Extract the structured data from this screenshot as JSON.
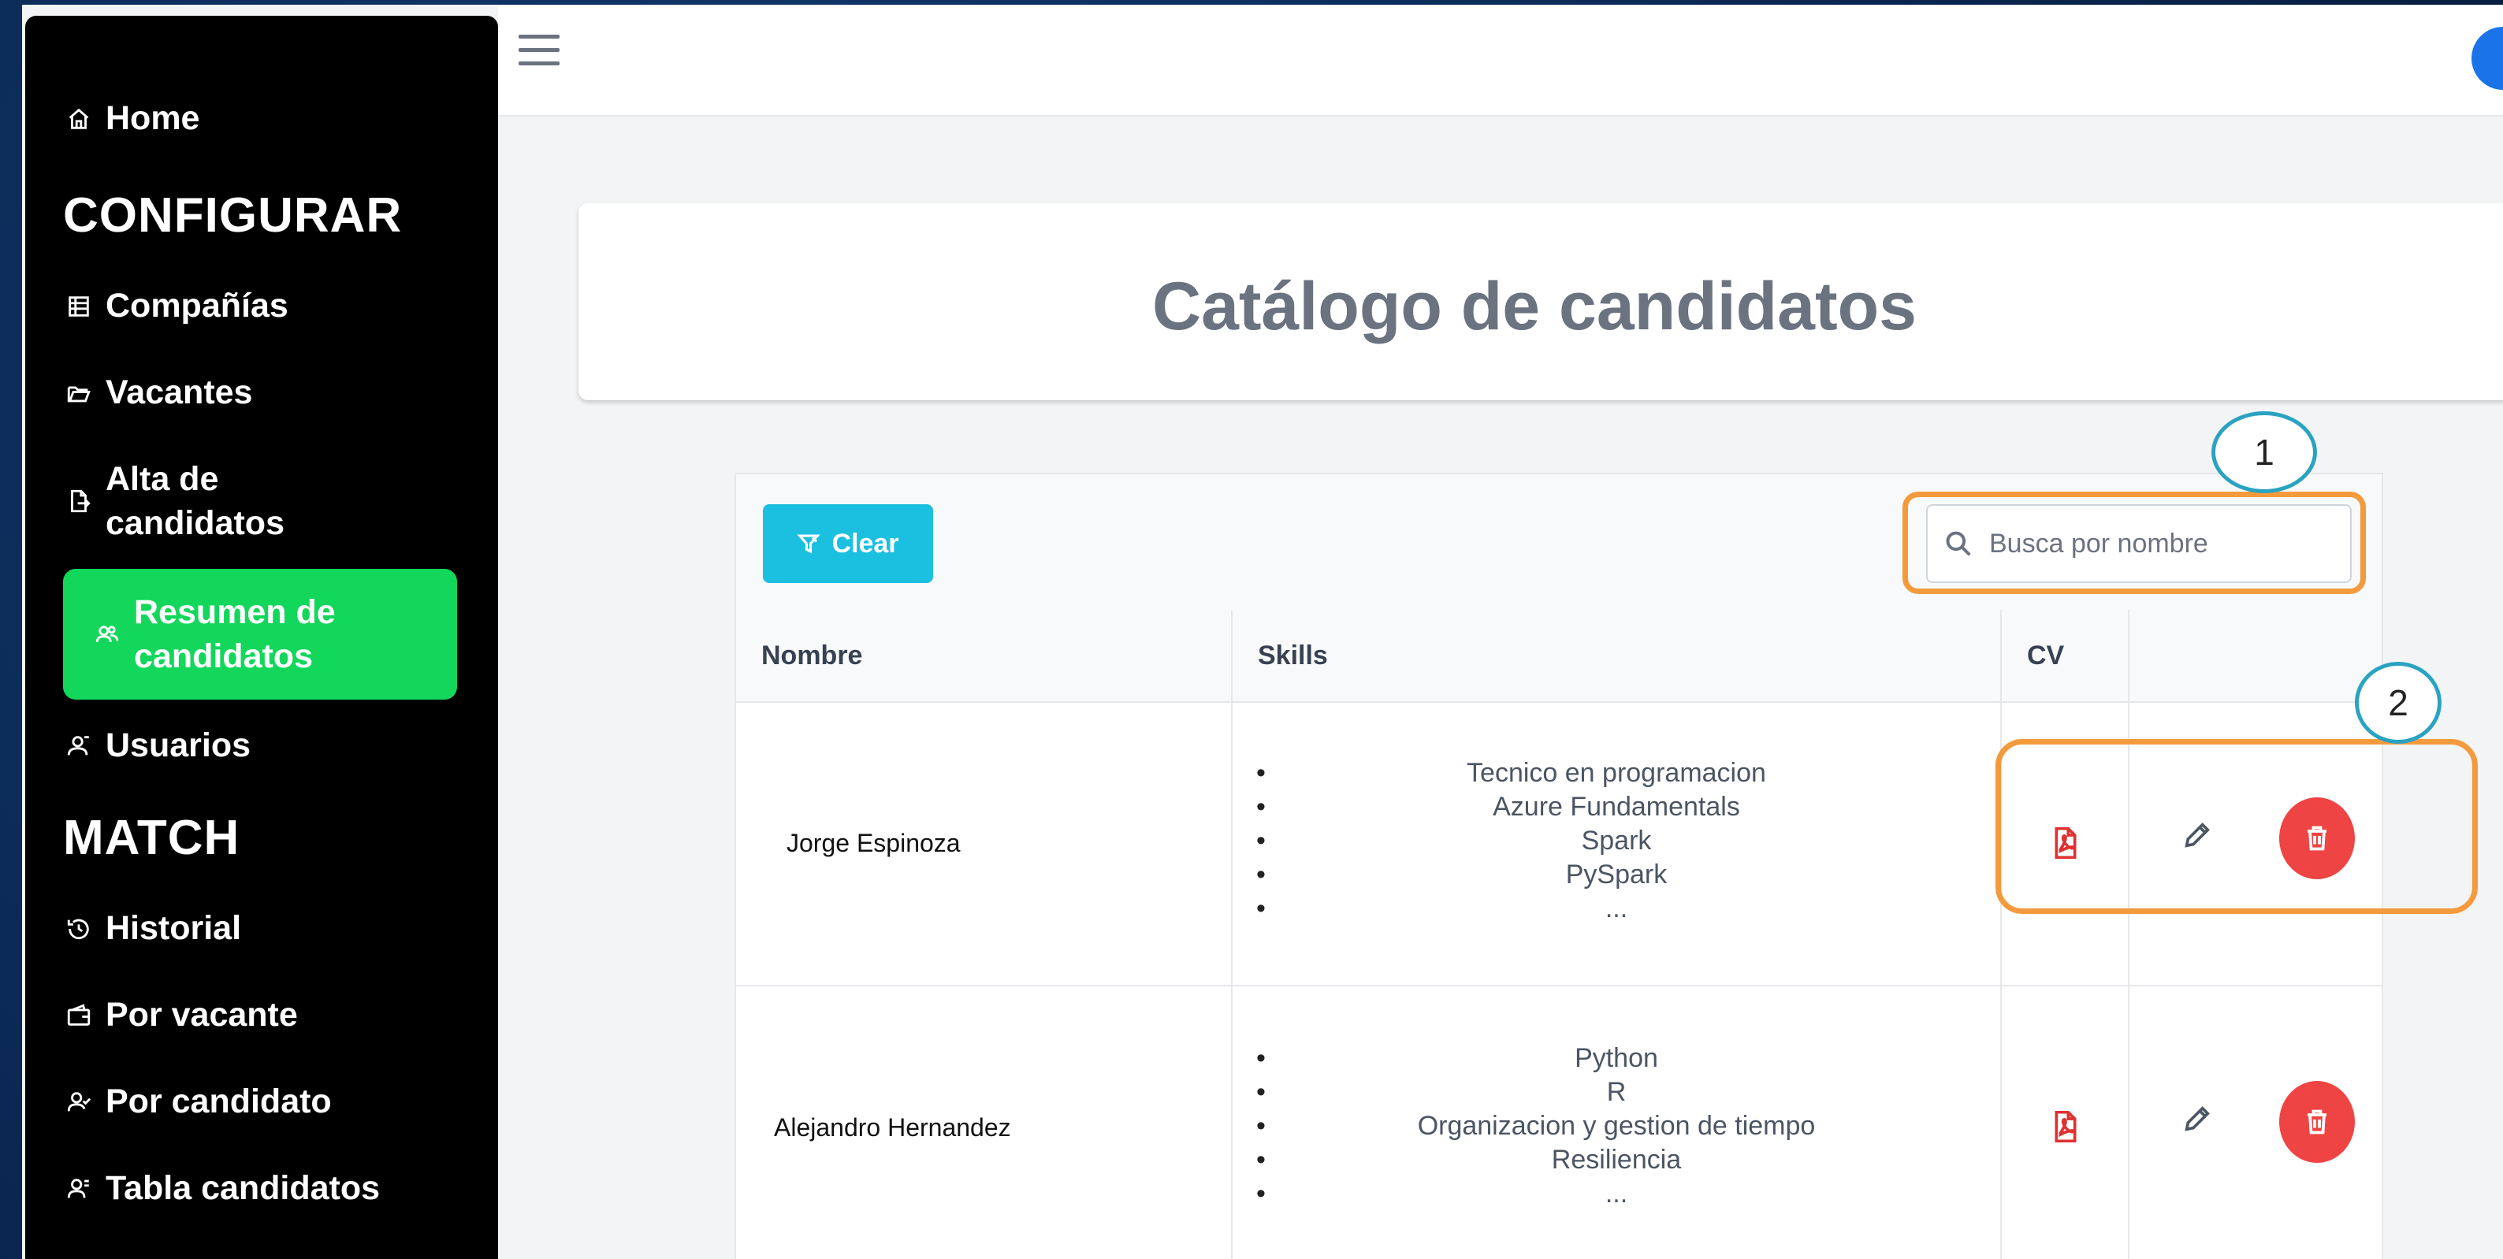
{
  "sidebar": {
    "home": "Home",
    "section_configurar": "CONFIGURAR",
    "companias": "Compañías",
    "vacantes": "Vacantes",
    "alta_line1": "Alta de",
    "alta_line2": "candidatos",
    "resumen_line1": "Resumen de",
    "resumen_line2": "candidatos",
    "usuarios": "Usuarios",
    "section_match": "MATCH",
    "historial": "Historial",
    "por_vacante": "Por vacante",
    "por_candidato": "Por candidato",
    "tabla_candidatos": "Tabla candidatos"
  },
  "page": {
    "title": "Catálogo de candidatos"
  },
  "toolbar": {
    "clear_label": "Clear",
    "search_placeholder": "Busca por nombre"
  },
  "table": {
    "headers": {
      "nombre": "Nombre",
      "skills": "Skills",
      "cv": "CV",
      "actions": ""
    },
    "rows": [
      {
        "name": "Jorge Espinoza",
        "skills": [
          "Tecnico en programacion",
          "Azure Fundamentals",
          "Spark",
          "PySpark",
          "..."
        ]
      },
      {
        "name": "Alejandro Hernandez",
        "skills": [
          "Python",
          "R",
          "Organizacion y gestion de tiempo",
          "Resiliencia",
          "..."
        ]
      }
    ]
  },
  "annotations": {
    "marker1": "1",
    "marker2": "2"
  },
  "colors": {
    "sidebar_bg": "#000000",
    "active_item": "#12d75b",
    "clear_button": "#1bbfdf",
    "delete_button": "#ef4444",
    "highlight": "#f39a3c",
    "marker_ring": "#2aa3c1"
  }
}
